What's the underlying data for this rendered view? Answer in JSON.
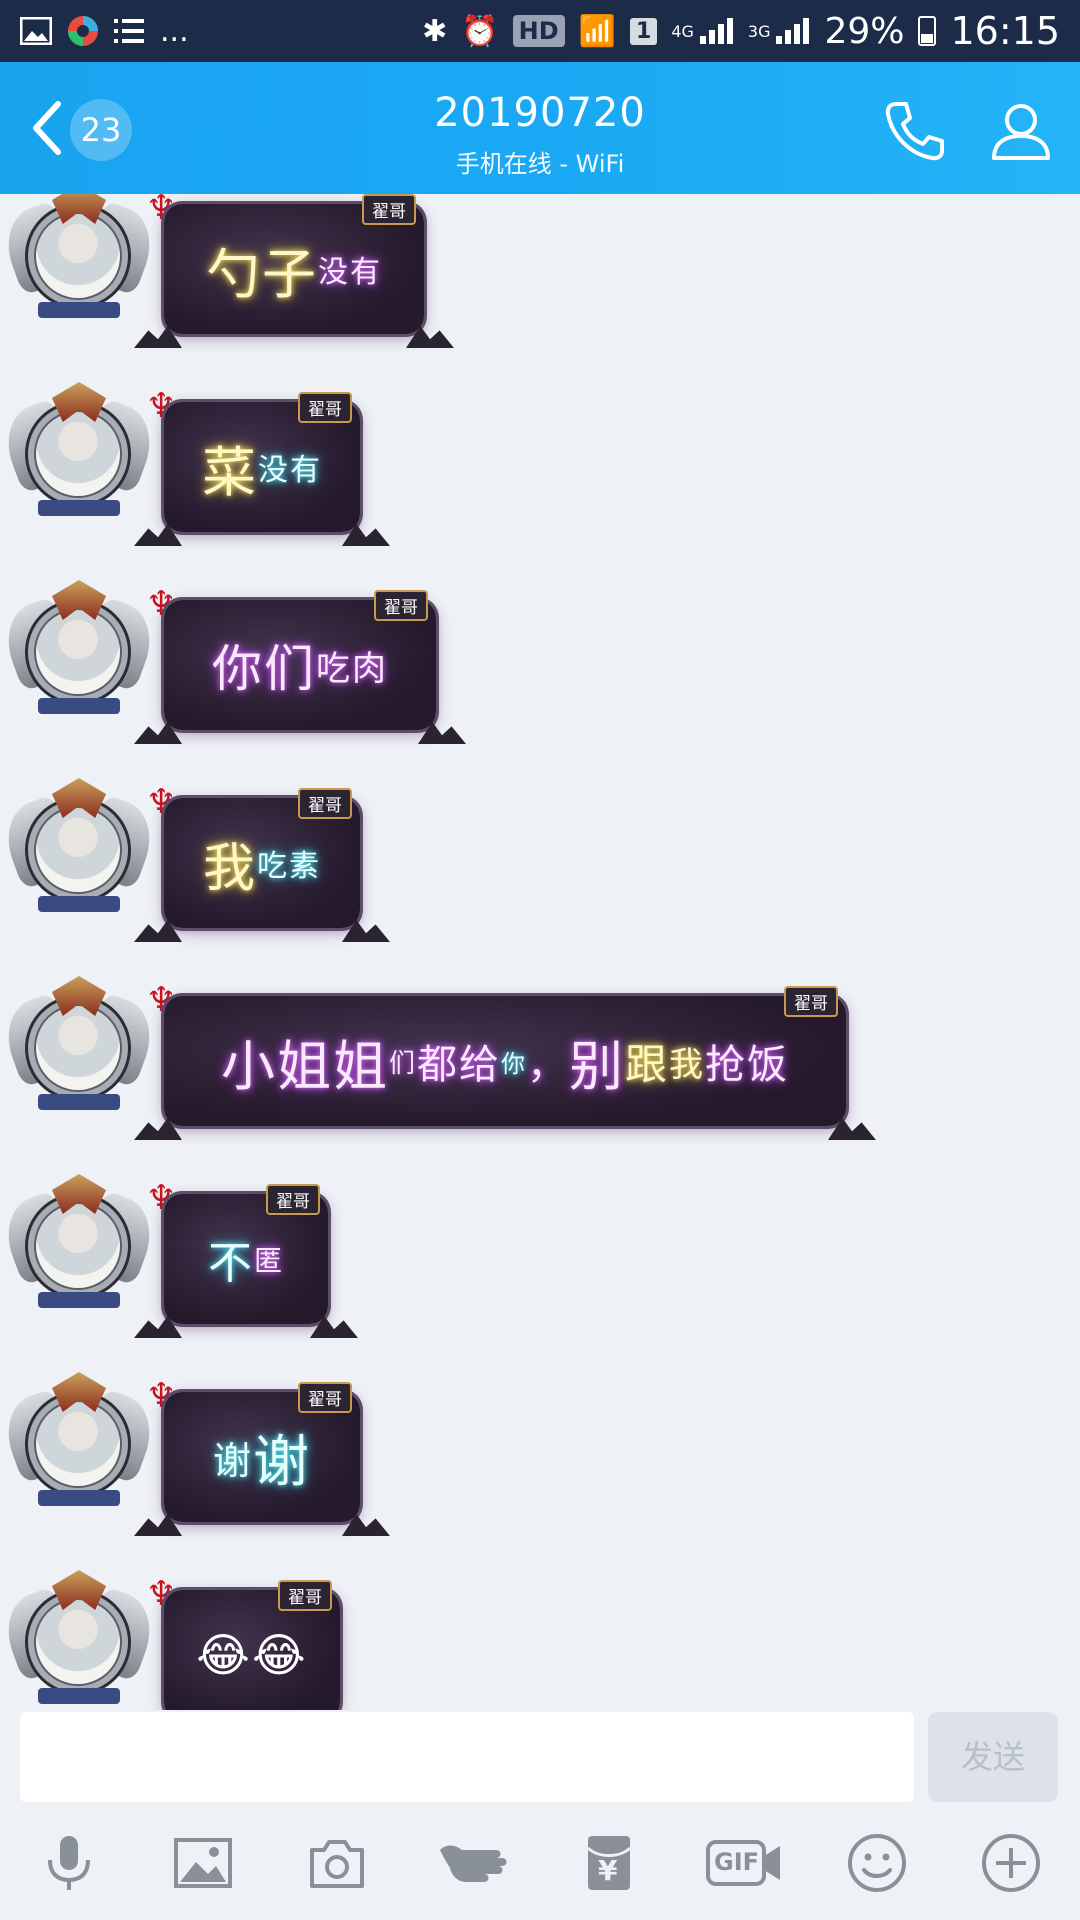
{
  "status_bar": {
    "left_icons": [
      "gallery-icon",
      "app-icon",
      "list-icon"
    ],
    "more": "...",
    "hd": "HD",
    "sim": "1",
    "net1": "4G",
    "net2": "3G",
    "battery": "29%",
    "time": "16:15"
  },
  "header": {
    "unread_count": "23",
    "title": "20190720",
    "subtitle": "手机在线 - WiFi"
  },
  "messages": [
    {
      "tag": "翟哥",
      "parts": [
        {
          "t": "勺子",
          "c": "glow-y",
          "s": "54px"
        },
        {
          "t": "没有",
          "c": "glow-p",
          "s": "30px"
        }
      ]
    },
    {
      "tag": "翟哥",
      "parts": [
        {
          "t": "菜",
          "c": "glow-y",
          "s": "54px"
        },
        {
          "t": "没有",
          "c": "glow-c",
          "s": "30px"
        }
      ]
    },
    {
      "tag": "翟哥",
      "parts": [
        {
          "t": "你们",
          "c": "glow-p",
          "s": "50px"
        },
        {
          "t": "吃肉",
          "c": "glow-p",
          "s": "34px"
        }
      ]
    },
    {
      "tag": "翟哥",
      "parts": [
        {
          "t": "我",
          "c": "glow-y",
          "s": "52px"
        },
        {
          "t": "吃素",
          "c": "glow-c",
          "s": "30px"
        }
      ]
    },
    {
      "tag": "翟哥",
      "parts": [
        {
          "t": "小姐姐",
          "c": "glow-p",
          "s": "54px"
        },
        {
          "t": "们",
          "c": "glow-p",
          "s": "26px"
        },
        {
          "t": "都给",
          "c": "glow-p",
          "s": "40px"
        },
        {
          "t": "你",
          "c": "glow-c",
          "s": "24px"
        },
        {
          "t": "，",
          "c": "glow-p",
          "s": "40px"
        },
        {
          "t": "别",
          "c": "glow-p",
          "s": "54px"
        },
        {
          "t": "跟",
          "c": "glow-y",
          "s": "42px"
        },
        {
          "t": "我",
          "c": "glow-y",
          "s": "34px"
        },
        {
          "t": "抢饭",
          "c": "glow-p",
          "s": "40px"
        }
      ]
    },
    {
      "tag": "翟哥",
      "parts": [
        {
          "t": "不",
          "c": "glow-c",
          "s": "44px"
        },
        {
          "t": "匿",
          "c": "glow-p",
          "s": "28px"
        }
      ]
    },
    {
      "tag": "翟哥",
      "parts": [
        {
          "t": "谢",
          "c": "glow-c",
          "s": "38px"
        },
        {
          "t": "谢",
          "c": "glow-c",
          "s": "56px"
        }
      ]
    },
    {
      "tag": "翟哥",
      "parts": [
        {
          "t": "😂😂",
          "c": "",
          "s": "46px"
        }
      ]
    }
  ],
  "input": {
    "placeholder": "",
    "send_label": "发送"
  },
  "toolbar": {
    "items": [
      "microphone-icon",
      "image-icon",
      "camera-icon",
      "poke-icon",
      "red-packet-icon",
      "gif-icon",
      "emoji-icon",
      "plus-icon"
    ],
    "gif_label": "GIF",
    "yen_label": "¥"
  }
}
